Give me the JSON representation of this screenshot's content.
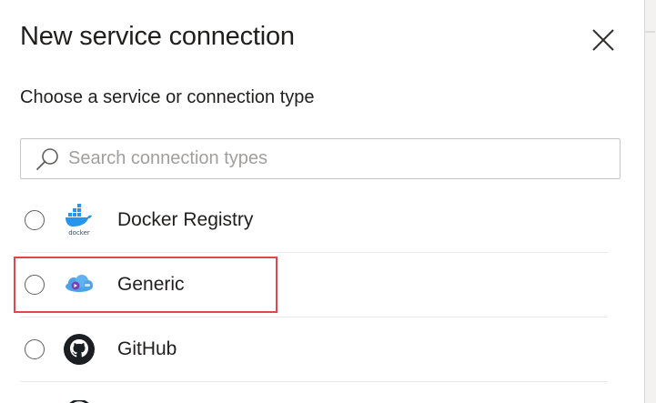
{
  "dialog": {
    "title": "New service connection",
    "subtitle": "Choose a service or connection type"
  },
  "search": {
    "placeholder": "Search connection types",
    "value": ""
  },
  "connection_types": [
    {
      "label": "Docker Registry",
      "icon": "docker-icon",
      "selected": false
    },
    {
      "label": "Generic",
      "icon": "generic-cloud-icon",
      "selected": false
    },
    {
      "label": "GitHub",
      "icon": "github-icon",
      "selected": false
    }
  ],
  "colors": {
    "highlight": "#e0474c",
    "docker_blue": "#2496ed",
    "generic_blue": "#4da3e8",
    "generic_purple": "#7b3fb5",
    "text": "#201f1e",
    "placeholder": "#a19f9d"
  }
}
